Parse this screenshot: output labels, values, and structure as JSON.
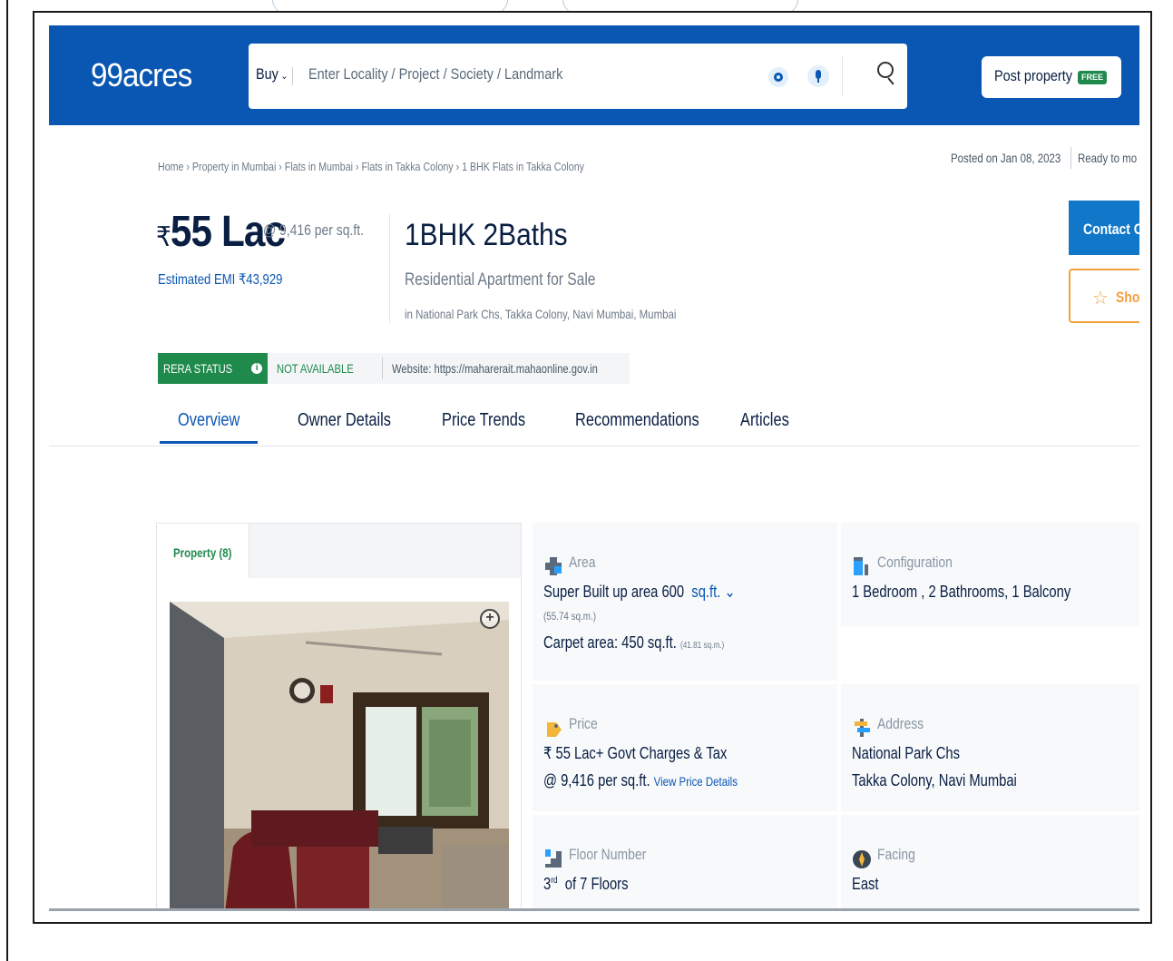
{
  "header": {
    "logo": "99acres",
    "search": {
      "buy_label": "Buy",
      "placeholder": "Enter Locality / Project / Society / Landmark"
    },
    "post_property": {
      "label": "Post property",
      "badge": "FREE"
    }
  },
  "breadcrumb": "Home › Property in Mumbai › Flats in Mumbai › Flats in Takka Colony › 1 BHK Flats in Takka Colony",
  "posted_on": "Posted on Jan 08, 2023",
  "ready_status": "Ready to mo",
  "price": {
    "rupee": "₹",
    "amount": "55 Lac",
    "per_sqft": "@ 9,416 per sq.ft.",
    "emi": "Estimated EMI ₹43,929"
  },
  "property": {
    "title": "1BHK 2Baths",
    "type": "Residential Apartment for Sale",
    "location": "in National Park Chs, Takka Colony, Navi Mumbai, Mumbai"
  },
  "actions": {
    "contact": "Contact O",
    "shortlist": "Sho"
  },
  "rera": {
    "badge": "RERA STATUS",
    "status": "NOT AVAILABLE",
    "website": "Website: https://maharerait.mahaonline.gov.in"
  },
  "tabs": [
    "Overview",
    "Owner Details",
    "Price Trends",
    "Recommendations",
    "Articles"
  ],
  "gallery": {
    "tab_label": "Property (8)"
  },
  "details": {
    "area": {
      "label": "Area",
      "super_built_up": "Super Built up area 600",
      "unit": "sq.ft.",
      "super_built_up_sqm": "(55.74 sq.m.)",
      "carpet": "Carpet area: 450 sq.ft.",
      "carpet_sqm": "(41.81 sq.m.)"
    },
    "configuration": {
      "label": "Configuration",
      "value": "1 Bedroom , 2 Bathrooms, 1 Balcony"
    },
    "price": {
      "label": "Price",
      "value": "₹ 55 Lac+ Govt Charges & Tax",
      "per_sqft": "@ 9,416 per sq.ft.",
      "link": "View Price Details"
    },
    "address": {
      "label": "Address",
      "line1": "National Park Chs",
      "line2": "Takka Colony, Navi Mumbai"
    },
    "floor": {
      "label": "Floor Number",
      "floor": "3",
      "suffix": "rd",
      "of": "of 7 Floors"
    },
    "facing": {
      "label": "Facing",
      "value": "East"
    }
  },
  "colors": {
    "header_blue": "#0a56b3",
    "rera_green": "#1f8a4c",
    "shortlist_orange": "#f3a03c",
    "contact_blue": "#1177c8"
  }
}
